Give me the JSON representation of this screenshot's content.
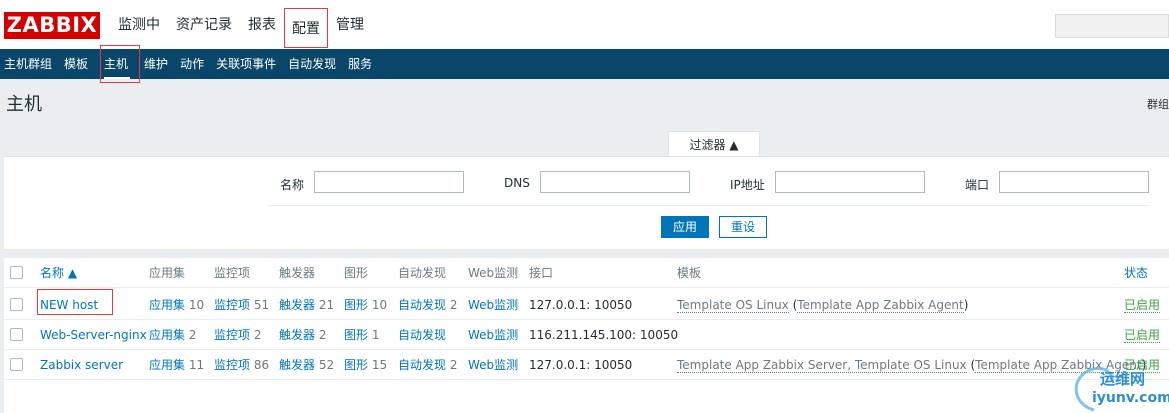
{
  "logo": "ZABBIX",
  "top_nav": [
    {
      "label": "监测中",
      "active": false
    },
    {
      "label": "资产记录",
      "active": false
    },
    {
      "label": "报表",
      "active": false
    },
    {
      "label": "配置",
      "active": true
    },
    {
      "label": "管理",
      "active": false
    }
  ],
  "sub_nav": [
    {
      "label": "主机群组"
    },
    {
      "label": "模板"
    },
    {
      "label": "主机",
      "active": true
    },
    {
      "label": "维护"
    },
    {
      "label": "动作"
    },
    {
      "label": "关联项事件"
    },
    {
      "label": "自动发现"
    },
    {
      "label": "服务"
    }
  ],
  "page": {
    "title": "主机",
    "group_label": "群组"
  },
  "filter": {
    "tab_label": "过滤器 ▲",
    "name_label": "名称",
    "name_value": "",
    "dns_label": "DNS",
    "dns_value": "",
    "ip_label": "IP地址",
    "ip_value": "",
    "port_label": "端口",
    "port_value": "",
    "apply_label": "应用",
    "reset_label": "重设"
  },
  "table": {
    "headers": {
      "name": "名称 ▲",
      "applications": "应用集",
      "items": "监控项",
      "triggers": "触发器",
      "graphs": "图形",
      "discovery": "自动发现",
      "web": "Web监测",
      "interface": "接口",
      "templates": "模板",
      "status": "状态"
    },
    "rows": [
      {
        "name": "NEW host",
        "applications_label": "应用集",
        "applications_count": "10",
        "items_label": "监控项",
        "items_count": "51",
        "triggers_label": "触发器",
        "triggers_count": "21",
        "graphs_label": "图形",
        "graphs_count": "10",
        "discovery_label": "自动发现",
        "discovery_count": "2",
        "web_label": "Web监测",
        "interface": "127.0.0.1: 10050",
        "templates": "Template OS Linux",
        "templates_paren": "Template App Zabbix Agent",
        "status": "已启用"
      },
      {
        "name": "Web-Server-nginx",
        "applications_label": "应用集",
        "applications_count": "2",
        "items_label": "监控项",
        "items_count": "2",
        "triggers_label": "触发器",
        "triggers_count": "2",
        "graphs_label": "图形",
        "graphs_count": "1",
        "discovery_label": "自动发现",
        "discovery_count": "",
        "web_label": "Web监测",
        "interface": "116.211.145.100: 10050",
        "templates": "",
        "templates_paren": "",
        "status": "已启用"
      },
      {
        "name": "Zabbix server",
        "applications_label": "应用集",
        "applications_count": "11",
        "items_label": "监控项",
        "items_count": "86",
        "triggers_label": "触发器",
        "triggers_count": "52",
        "graphs_label": "图形",
        "graphs_count": "15",
        "discovery_label": "自动发现",
        "discovery_count": "2",
        "web_label": "Web监测",
        "interface": "127.0.0.1: 10050",
        "templates": "Template App Zabbix Server, Template OS Linux",
        "templates_paren": "Template App Zabbix Agent",
        "status": "已启用"
      }
    ]
  },
  "watermark": {
    "line1": "运维网",
    "line2": "iyunv.com"
  },
  "colors": {
    "brand_red": "#d40000",
    "nav_dark": "#0a466a",
    "link": "#0275b8",
    "enabled": "#429e47"
  }
}
